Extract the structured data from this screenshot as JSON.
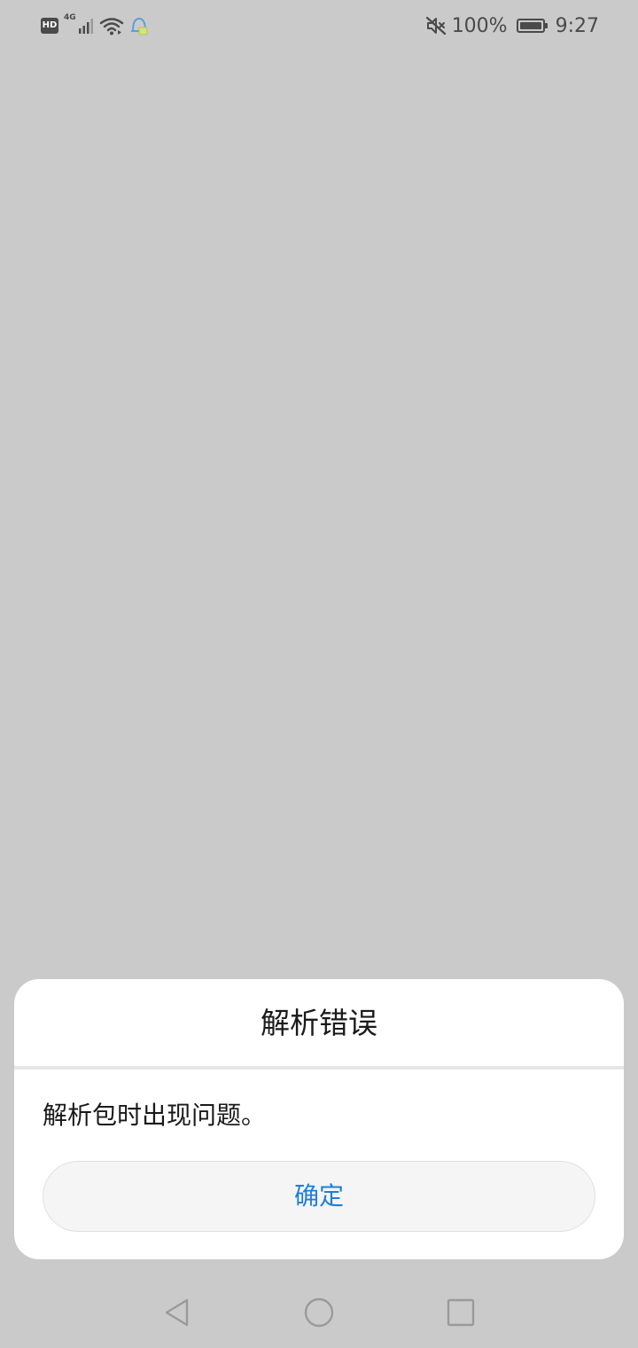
{
  "status_bar": {
    "hd_label": "HD",
    "network_type": "4G",
    "battery_percent": "100%",
    "battery_level": 1.0,
    "time": "9:27",
    "icons": [
      "hd-icon",
      "signal-icon",
      "wifi-icon",
      "notification-icon",
      "mute-icon",
      "battery-icon"
    ]
  },
  "dialog": {
    "title": "解析错误",
    "message": "解析包时出现问题。",
    "confirm_label": "确定"
  },
  "nav_bar": {
    "icons": [
      "back-icon",
      "home-icon",
      "recent-apps-icon"
    ]
  },
  "colors": {
    "background": "#cacaca",
    "dialog_bg": "#ffffff",
    "button_text": "#1e7fd8",
    "button_bg": "#f5f5f5",
    "status_icons": "#4a4a4a",
    "notification_icon": "#5aa0e0"
  }
}
